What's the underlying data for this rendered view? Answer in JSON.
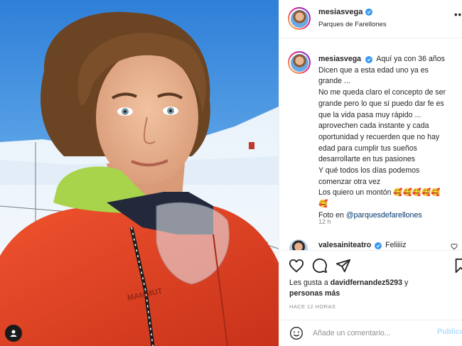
{
  "post": {
    "username": "mesiasvega",
    "location": "Parques de Farellones",
    "caption_text": "Aquí ya con 36 años",
    "caption_lines": [
      "Dicen que a esta edad uno ya es",
      "grande ...",
      "No me queda claro el concepto de ser",
      "grande pero lo que sí puedo dar fe es",
      "que la vida pasa muy rápido ...",
      "aprovechen cada instante y cada",
      "oportunidad y recuerden que no hay",
      "edad para cumplir tus sueños",
      "desarrollarte en tus pasiones",
      "Y qué todos los días podemos",
      "comenzar otra vez"
    ],
    "love_line": "Los quiero un montón 🥰🥰🥰🥰🥰",
    "love_line_2": "🥰",
    "photo_credit_prefix": "Foto en ",
    "photo_credit_link": "@parquesdefarellones",
    "caption_time": "12 h"
  },
  "comment": {
    "username": "valesainiteatro",
    "text": "Feliiiiz"
  },
  "likes": {
    "prefix": "Les gusta a ",
    "user": "davidfernandez5293",
    "connector": " y",
    "others": "personas más"
  },
  "posted_ago": "HACE 12 HORAS",
  "add_comment": {
    "placeholder": "Añade un comentario...",
    "post_label": "Publicar"
  },
  "colors": {
    "verified": "#3897f0",
    "link": "#00376b",
    "secondary_text": "#8e8e8e",
    "post_button_disabled": "#b2dffc",
    "jacket": "#e8421f"
  },
  "icons": [
    "verified-badge-icon",
    "more-options-icon",
    "like-heart-icon",
    "comment-icon",
    "share-icon",
    "save-bookmark-icon",
    "emoji-icon",
    "user-tag-icon",
    "comment-like-heart-icon"
  ]
}
